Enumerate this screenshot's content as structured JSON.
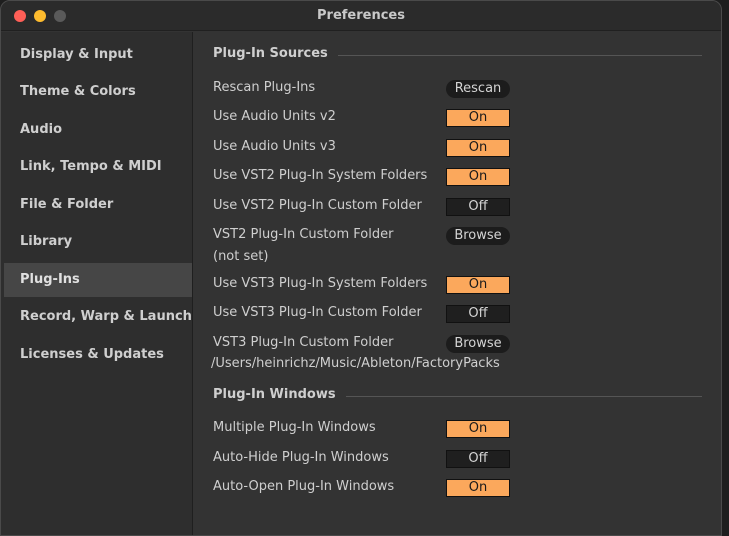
{
  "window": {
    "title": "Preferences"
  },
  "sidebar": {
    "items": [
      {
        "label": "Display & Input"
      },
      {
        "label": "Theme & Colors"
      },
      {
        "label": "Audio"
      },
      {
        "label": "Link, Tempo & MIDI"
      },
      {
        "label": "File & Folder"
      },
      {
        "label": "Library"
      },
      {
        "label": "Plug-Ins",
        "active": true
      },
      {
        "label": "Record, Warp & Launch"
      },
      {
        "label": "Licenses & Updates"
      }
    ]
  },
  "sources": {
    "heading": "Plug-In Sources",
    "rescan": {
      "label": "Rescan Plug-Ins",
      "button": "Rescan"
    },
    "au2": {
      "label": "Use Audio Units v2",
      "value": "On"
    },
    "au3": {
      "label": "Use Audio Units v3",
      "value": "On"
    },
    "vst2_system": {
      "label": "Use VST2 Plug-In System Folders",
      "value": "On"
    },
    "vst2_custom": {
      "label": "Use VST2 Plug-In Custom Folder",
      "value": "Off"
    },
    "vst2_folder": {
      "label": "VST2 Plug-In Custom Folder",
      "button": "Browse",
      "path": "(not set)"
    },
    "vst3_system": {
      "label": "Use VST3 Plug-In System Folders",
      "value": "On"
    },
    "vst3_custom": {
      "label": "Use VST3 Plug-In Custom Folder",
      "value": "Off"
    },
    "vst3_folder": {
      "label": "VST3 Plug-In Custom Folder",
      "button": "Browse",
      "path": "/Users/heinrichz/Music/Ableton/FactoryPacks"
    }
  },
  "windows": {
    "heading": "Plug-In Windows",
    "multiple": {
      "label": "Multiple Plug-In Windows",
      "value": "On"
    },
    "autohide": {
      "label": "Auto-Hide Plug-In Windows",
      "value": "Off"
    },
    "autoopen": {
      "label": "Auto-Open Plug-In Windows",
      "value": "On"
    }
  },
  "colors": {
    "accent": "#fba85c",
    "background": "#333333",
    "sidebar": "#2e2e2e"
  }
}
